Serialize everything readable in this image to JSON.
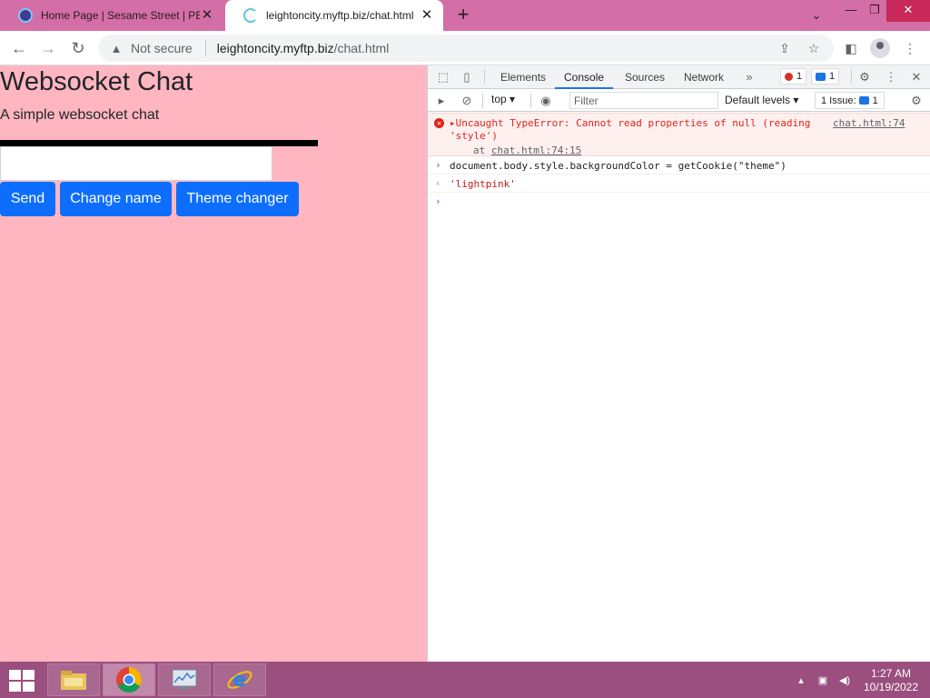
{
  "browser": {
    "tabs": [
      {
        "title": "Home Page | Sesame Street | PBS",
        "active": false
      },
      {
        "title": "leightoncity.myftp.biz/chat.html",
        "active": true
      }
    ],
    "address": {
      "security_label": "Not secure",
      "host": "leightoncity.myftp.biz",
      "path": "/chat.html"
    }
  },
  "page": {
    "heading": "Websocket Chat",
    "subtitle": "A simple websocket chat",
    "input_value": "",
    "buttons": {
      "send": "Send",
      "change_name": "Change name",
      "theme": "Theme changer"
    },
    "background_color": "#ffb6c1",
    "button_color": "#0d6efd"
  },
  "devtools": {
    "tabs": [
      "Elements",
      "Console",
      "Sources",
      "Network"
    ],
    "active_tab": "Console",
    "error_count": "1",
    "message_count": "1",
    "context": "top",
    "filter_placeholder": "Filter",
    "levels": "Default levels",
    "issues_label": "1 Issue:",
    "issues_count": "1",
    "console": {
      "error_text": "Uncaught TypeError: Cannot read properties of null (reading\n'style')",
      "error_link": "chat.html:74",
      "error_at": "at",
      "error_at_link": "chat.html:74:15",
      "input_line": "document.body.style.backgroundColor = getCookie(\"theme\")",
      "result_line": "'lightpink'"
    }
  },
  "taskbar": {
    "time": "1:27 AM",
    "date": "10/19/2022",
    "apps": [
      "file-explorer-icon",
      "chrome-icon",
      "resource-monitor-icon",
      "internet-explorer-icon"
    ]
  }
}
